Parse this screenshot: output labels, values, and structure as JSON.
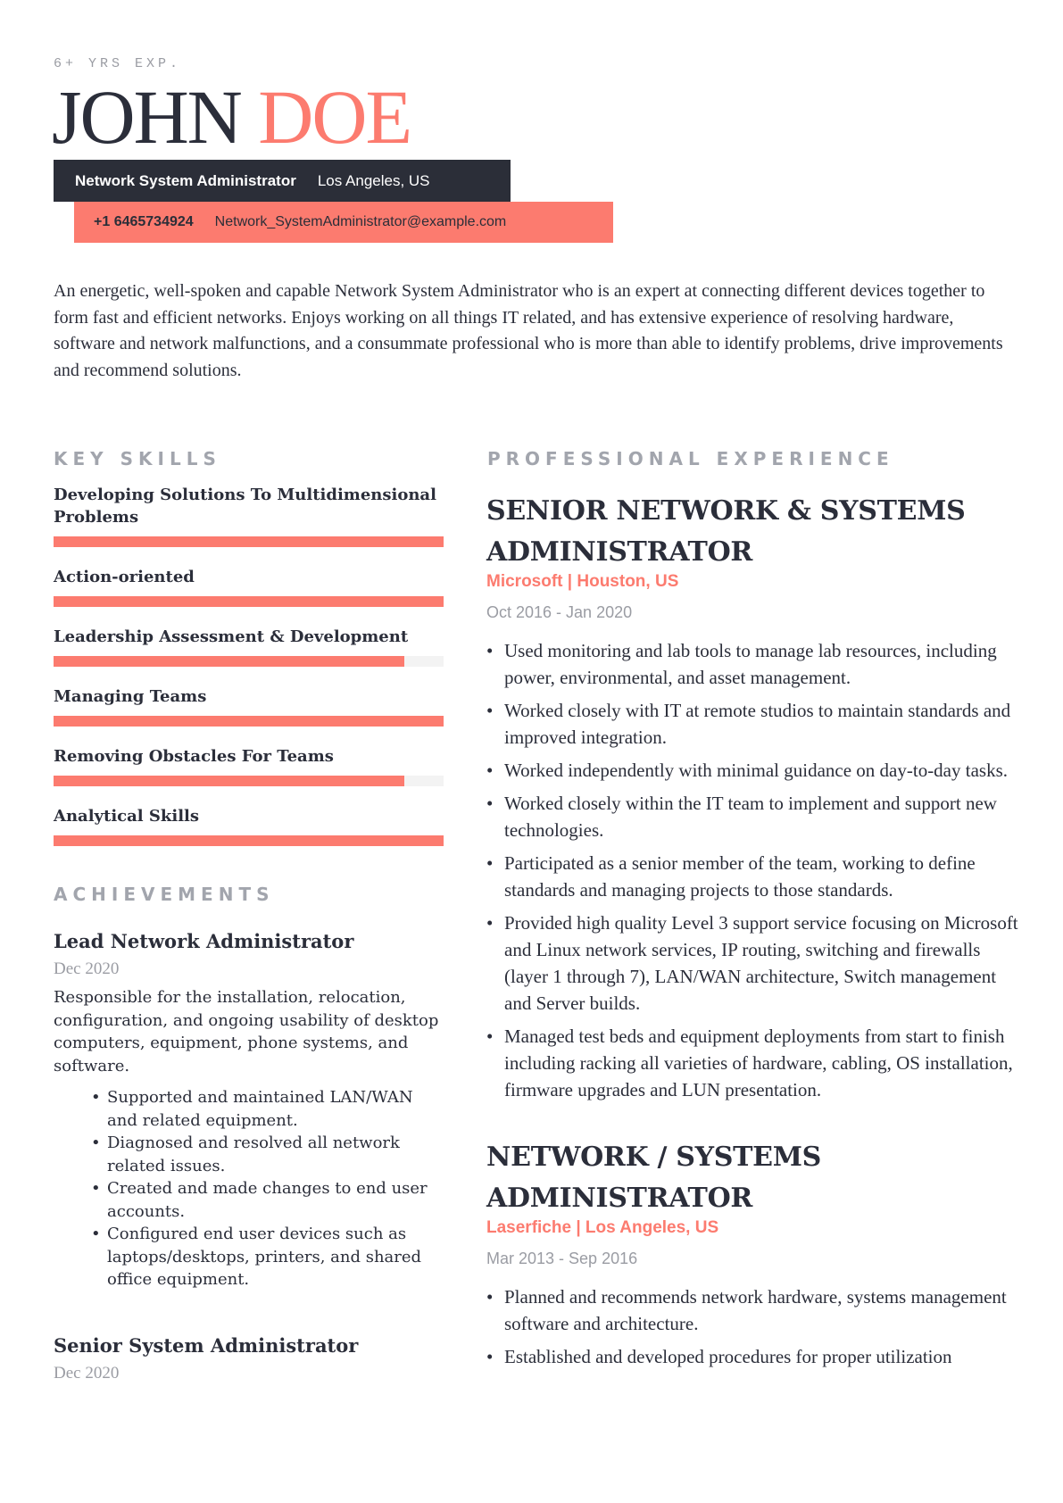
{
  "header": {
    "experience_badge": "6+ YRS EXP.",
    "first_name": "JOHN",
    "last_name": "DOE",
    "role": "Network System Administrator",
    "location": "Los Angeles, US",
    "phone": "+1 6465734924",
    "email": "Network_SystemAdministrator@example.com"
  },
  "summary": "An energetic, well-spoken and capable Network System Administrator who is an expert at connecting different devices together to form fast and efficient networks. Enjoys working on all things IT related, and has extensive experience of resolving hardware, software and network malfunctions, and a consummate professional who is more than able to identify problems, drive improvements and recommend solutions.",
  "colors": {
    "accent": "#fc7b6f",
    "dark": "#2b2e38",
    "muted": "#9a9ca3",
    "bar_track": "#f3f3f3"
  },
  "skills": {
    "heading": "KEY SKILLS",
    "items": [
      {
        "name": "Developing Solutions To Multidimensional Problems",
        "level_percent": 100
      },
      {
        "name": "Action-oriented",
        "level_percent": 100
      },
      {
        "name": "Leadership Assessment & Development",
        "level_percent": 90
      },
      {
        "name": "Managing Teams",
        "level_percent": 100
      },
      {
        "name": "Removing Obstacles For Teams",
        "level_percent": 90
      },
      {
        "name": "Analytical Skills",
        "level_percent": 100
      }
    ]
  },
  "achievements": {
    "heading": "ACHIEVEMENTS",
    "items": [
      {
        "title": "Lead Network Administrator",
        "date": "Dec 2020",
        "description": "Responsible for the installation, relocation, configuration, and ongoing usability of desktop computers, equipment, phone systems, and software.",
        "bullets": [
          "Supported and maintained LAN/WAN and related equipment.",
          "Diagnosed and resolved all network related issues.",
          "Created and made changes to end user accounts.",
          "Configured end user devices such as laptops/desktops, printers, and shared office equipment."
        ]
      },
      {
        "title": "Senior System Administrator",
        "date": "Dec 2020"
      }
    ]
  },
  "experience": {
    "heading": "PROFESSIONAL EXPERIENCE",
    "jobs": [
      {
        "title": "SENIOR NETWORK & SYSTEMS ADMINISTRATOR",
        "company": "Microsoft | Houston, US",
        "dates": "Oct 2016 - Jan 2020",
        "bullets": [
          "Used monitoring and lab tools to manage lab resources, including power, environmental, and asset management.",
          "Worked closely with IT at remote studios to maintain standards and improved integration.",
          "Worked independently with minimal guidance on day-to-day tasks.",
          "Worked closely within the IT team to implement and support new technologies.",
          "Participated as a senior member of the team, working to define standards and managing projects to those standards.",
          "Provided high quality Level 3 support service focusing on Microsoft and Linux network services, IP routing, switching and firewalls (layer 1 through 7), LAN/WAN architecture, Switch management and Server builds.",
          "Managed test beds and equipment deployments from start to finish including racking all varieties of hardware, cabling, OS installation, firmware upgrades and LUN presentation."
        ]
      },
      {
        "title": "NETWORK / SYSTEMS ADMINISTRATOR",
        "company": "Laserfiche | Los Angeles, US",
        "dates": "Mar 2013 - Sep 2016",
        "bullets": [
          "Planned and recommends network hardware, systems management software and architecture.",
          "Established and developed procedures for proper utilization"
        ]
      }
    ]
  }
}
